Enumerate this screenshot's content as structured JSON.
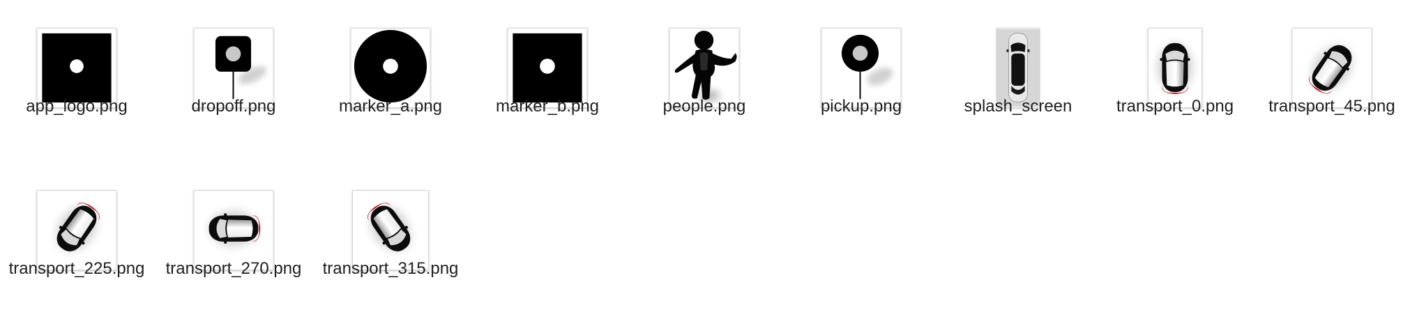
{
  "window": {
    "view": "icon-grid"
  },
  "files": [
    {
      "name": "app_logo.png",
      "icon": "app-logo-icon"
    },
    {
      "name": "dropoff.png",
      "icon": "dropoff-pin-icon"
    },
    {
      "name": "marker_a.png",
      "icon": "marker-ring-icon"
    },
    {
      "name": "marker_b.png",
      "icon": "marker-square-icon"
    },
    {
      "name": "people.png",
      "icon": "person-figure-icon"
    },
    {
      "name": "pickup.png",
      "icon": "pickup-pin-icon"
    },
    {
      "name": "splash_screen",
      "icon": "splash-car-icon"
    },
    {
      "name": "transport_0.png",
      "icon": "car-0deg-icon"
    },
    {
      "name": "transport_45.png",
      "icon": "car-45deg-icon"
    },
    {
      "name": "transport_225.png",
      "icon": "car-225deg-icon"
    },
    {
      "name": "transport_270.png",
      "icon": "car-270deg-icon"
    },
    {
      "name": "transport_315.png",
      "icon": "car-315deg-icon"
    }
  ],
  "colors": {
    "label_text": "#1e1e1e",
    "thumb_border": "#d4d4d4",
    "icon_black": "#000000",
    "car_red": "#b4131f",
    "marker_gray": "#c8c8c8"
  }
}
